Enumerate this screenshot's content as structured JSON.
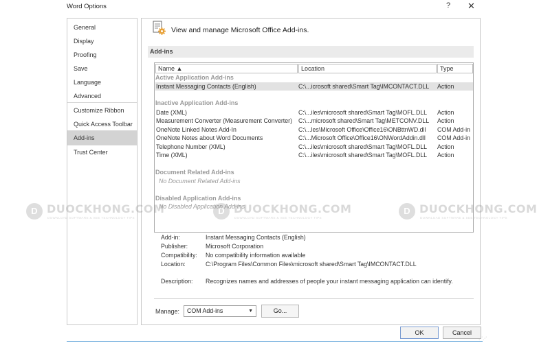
{
  "window": {
    "title": "Word Options",
    "help_label": "?",
    "close_label": "✕"
  },
  "sidebar": {
    "items": [
      {
        "label": "General"
      },
      {
        "label": "Display"
      },
      {
        "label": "Proofing"
      },
      {
        "label": "Save"
      },
      {
        "label": "Language"
      },
      {
        "label": "Advanced"
      },
      {
        "label": "Customize Ribbon"
      },
      {
        "label": "Quick Access Toolbar"
      },
      {
        "label": "Add-ins",
        "active": true
      },
      {
        "label": "Trust Center"
      }
    ]
  },
  "header": {
    "text": "View and manage Microsoft Office Add-ins.",
    "icon": "addins-gear-icon"
  },
  "section": {
    "title": "Add-ins"
  },
  "table": {
    "columns": [
      "Name ▲",
      "Location",
      "Type"
    ],
    "groups": {
      "active": "Active Application Add-ins",
      "inactive": "Inactive Application Add-ins",
      "document": "Document Related Add-ins",
      "disabled": "Disabled Application Add-ins"
    },
    "active_rows": [
      {
        "name": "Instant Messaging Contacts (English)",
        "location": "C:\\...icrosoft shared\\Smart Tag\\IMCONTACT.DLL",
        "type": "Action"
      }
    ],
    "inactive_rows": [
      {
        "name": "Date (XML)",
        "location": "C:\\...iles\\microsoft shared\\Smart Tag\\MOFL.DLL",
        "type": "Action"
      },
      {
        "name": "Measurement Converter (Measurement Converter)",
        "location": "C:\\...microsoft shared\\Smart Tag\\METCONV.DLL",
        "type": "Action"
      },
      {
        "name": "OneNote Linked Notes Add-In",
        "location": "C:\\...les\\Microsoft Office\\Office16\\ONBttnWD.dll",
        "type": "COM Add-in"
      },
      {
        "name": "OneNote Notes about Word Documents",
        "location": "C:\\...Microsoft Office\\Office16\\ONWordAddin.dll",
        "type": "COM Add-in"
      },
      {
        "name": "Telephone Number (XML)",
        "location": "C:\\...iles\\microsoft shared\\Smart Tag\\MOFL.DLL",
        "type": "Action"
      },
      {
        "name": "Time (XML)",
        "location": "C:\\...iles\\microsoft shared\\Smart Tag\\MOFL.DLL",
        "type": "Action"
      }
    ],
    "document_empty": "No Document Related Add-ins",
    "disabled_empty": "No Disabled Application Add-ins"
  },
  "details": {
    "addin_label": "Add-in:",
    "addin_value": "Instant Messaging Contacts (English)",
    "publisher_label": "Publisher:",
    "publisher_value": "Microsoft Corporation",
    "compat_label": "Compatibility:",
    "compat_value": "No compatibility information available",
    "location_label": "Location:",
    "location_value": "C:\\Program Files\\Common Files\\microsoft shared\\Smart Tag\\IMCONTACT.DLL",
    "description_label": "Description:",
    "description_value": "Recognizes names and addresses of people your instant messaging application can identify."
  },
  "manage": {
    "label": "Manage:",
    "selected": "COM Add-ins",
    "go_label": "Go..."
  },
  "footer": {
    "ok_label": "OK",
    "cancel_label": "Cancel"
  },
  "watermark": {
    "letter": "D",
    "brand": "DUOCKHONG.COM",
    "tagline": "DOWNLOAD SOFTWARE & SEE TECHNOLOGY TIPS"
  },
  "colors": {
    "sidebar_active": "#d3d3d3",
    "selected_row": "#e2e2e2",
    "section_bar": "#ebebeb",
    "ok_border": "#7a9bd1",
    "gear": "#e8a23a"
  }
}
